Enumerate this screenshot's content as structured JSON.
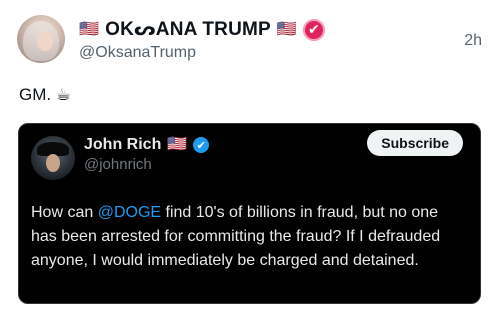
{
  "post": {
    "author_flag_left": "🇺🇸",
    "author_name": "OKᔕANA TRUMP",
    "author_flag_right": "🇺🇸",
    "verified_icon": "✔",
    "handle": "@OksanaTrump",
    "time": "2h",
    "text": "GM. ☕"
  },
  "quote": {
    "author_name": "John Rich",
    "author_flag": "🇺🇸",
    "verified_icon": "✔",
    "handle": "@johnrich",
    "subscribe_label": "Subscribe",
    "text_before": "How can ",
    "mention": "@DOGE",
    "text_after": " find 10's of billions in fraud, but no one has been arrested for committing the fraud? If I defrauded anyone, I would immediately be charged and detained."
  },
  "colors": {
    "accent_blue": "#1d9bf0",
    "verified_pink": "#e0245e",
    "quote_bg": "#000000"
  }
}
